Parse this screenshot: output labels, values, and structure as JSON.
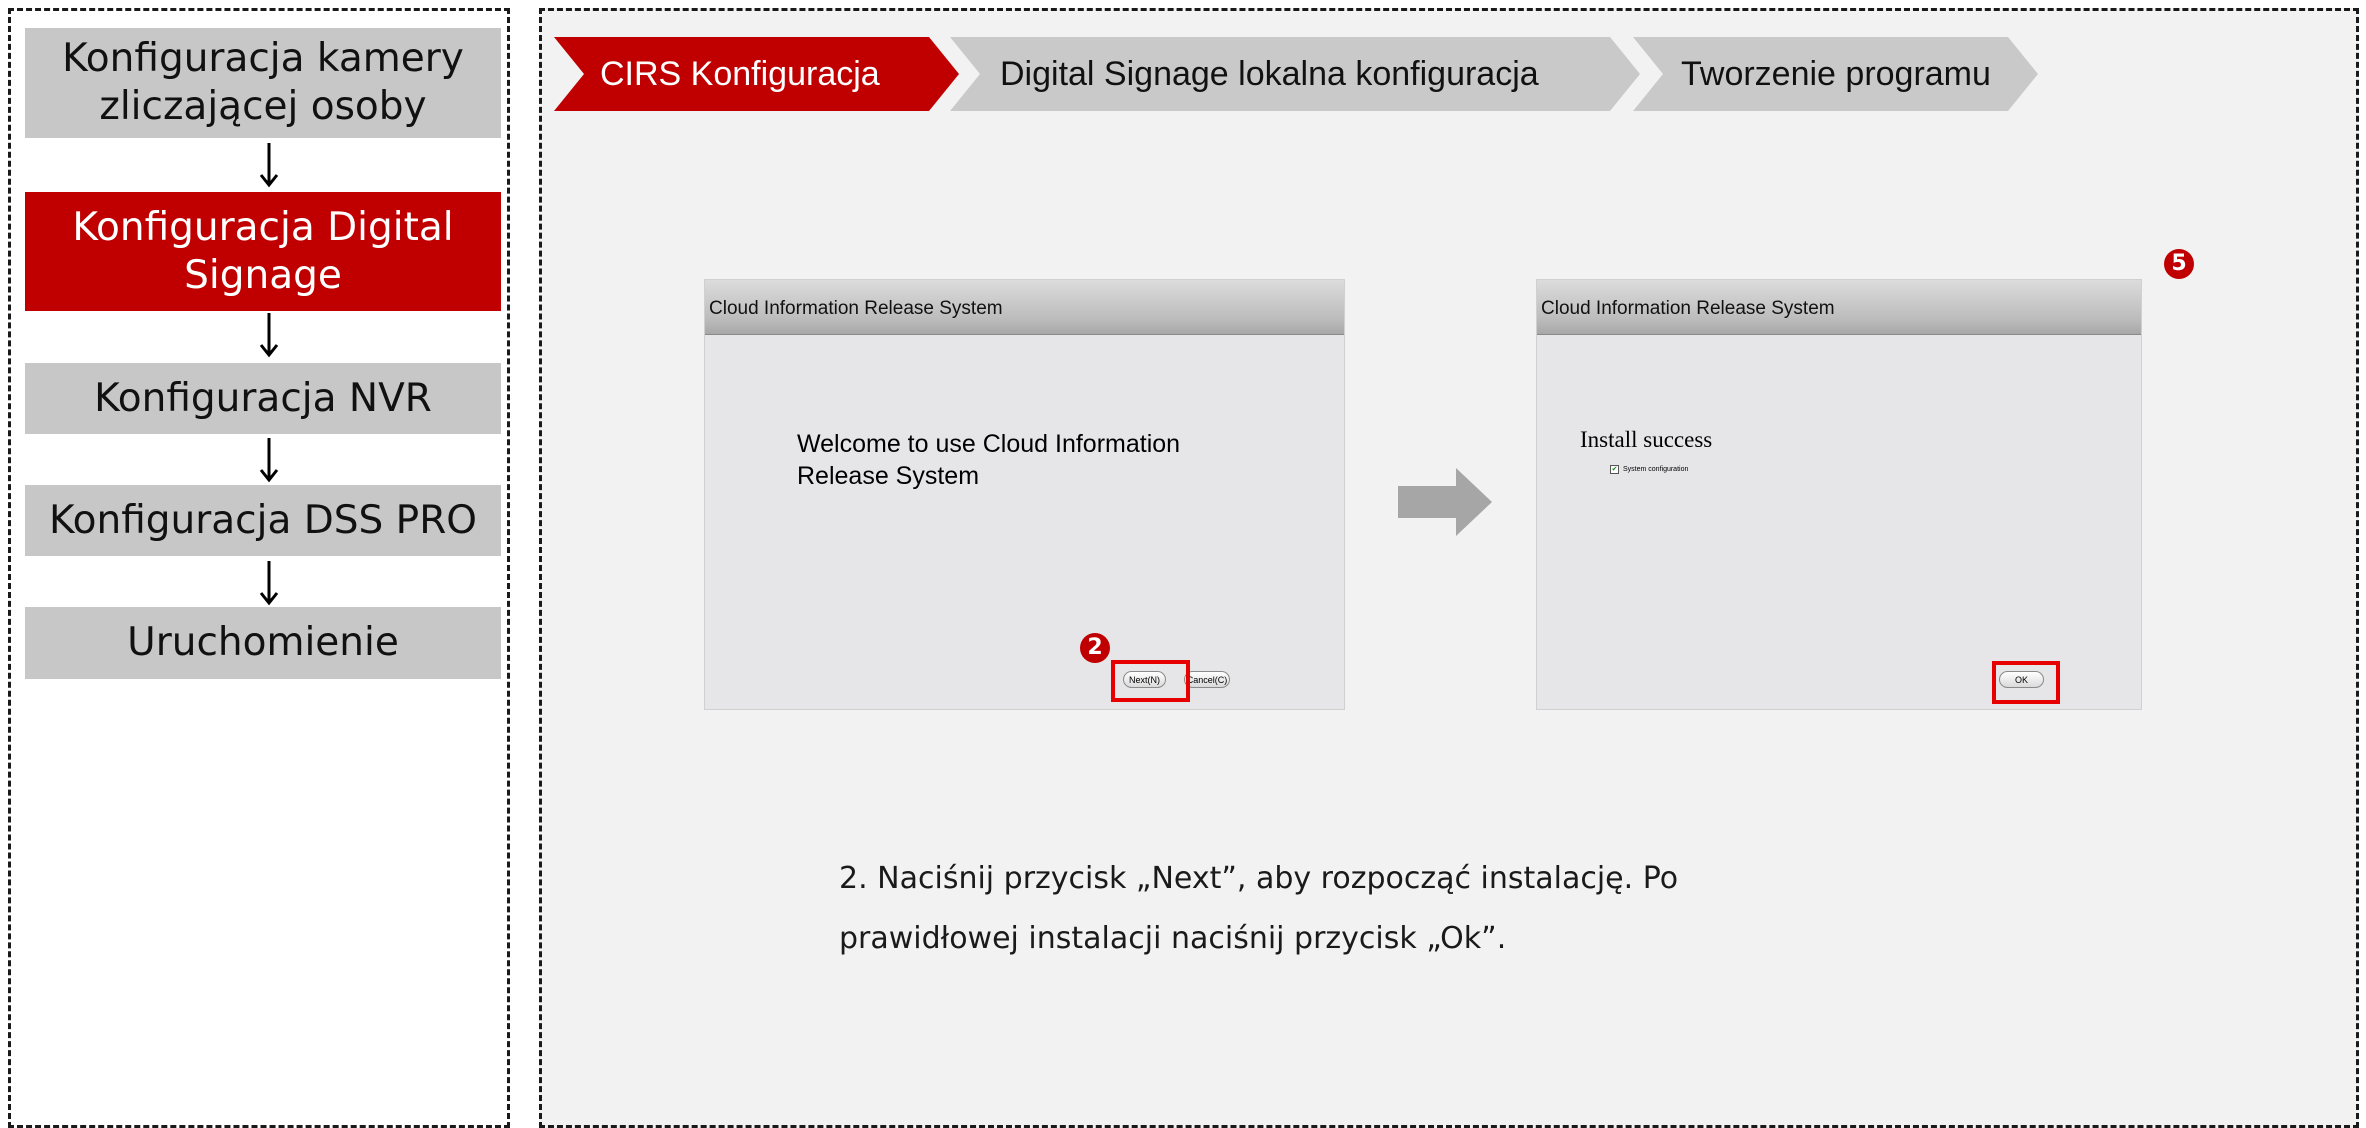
{
  "steps": [
    {
      "label": "Konfiguracja kamery zliczającej osoby",
      "active": false
    },
    {
      "label": "Konfiguracja Digital Signage",
      "active": true
    },
    {
      "label": "Konfiguracja NVR",
      "active": false
    },
    {
      "label": "Konfiguracja DSS PRO",
      "active": false
    },
    {
      "label": "Uruchomienie",
      "active": false
    }
  ],
  "breadcrumb": [
    {
      "label": "CIRS Konfiguracja",
      "active": true
    },
    {
      "label": "Digital Signage lokalna konfiguracja",
      "active": false
    },
    {
      "label": "Tworzenie programu",
      "active": false
    }
  ],
  "dialog_welcome": {
    "title": "Cloud Information Release System",
    "message": "Welcome to use Cloud Information Release System",
    "next_label": "Next(N)",
    "cancel_label": "Cancel(C)"
  },
  "dialog_success": {
    "title": "Cloud Information Release System",
    "message": "Install success",
    "checkbox_label": "System configuration",
    "checkbox_checked": true,
    "ok_label": "OK"
  },
  "badges": {
    "next_step": "2",
    "ok_step": "5"
  },
  "instruction": "2.   Naciśnij przycisk „Next”, aby rozpocząć instalację. Po prawidłowej instalacji naciśnij przycisk „Ok”.",
  "colors": {
    "accent": "#c00000",
    "step_inactive": "#c7c7c7",
    "highlight": "#e60000",
    "arrow": "#a6a6a6"
  }
}
